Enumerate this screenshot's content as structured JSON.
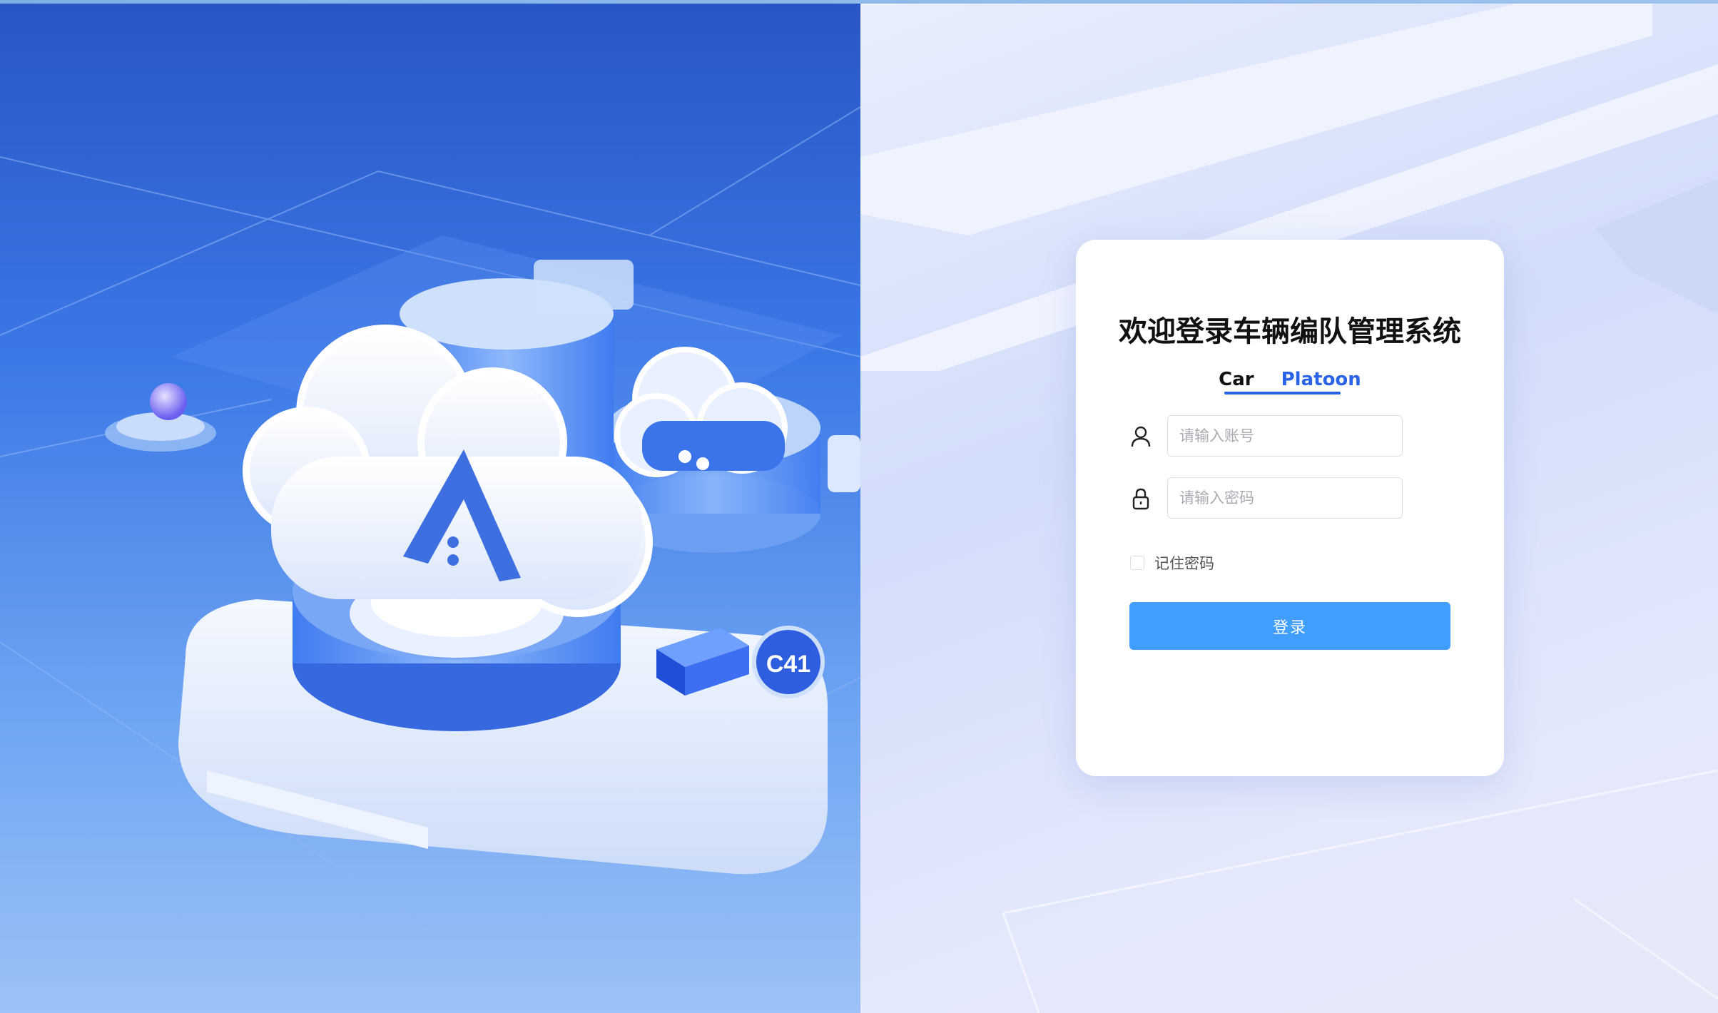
{
  "login": {
    "title": "欢迎登录车辆编队管理系统",
    "tabs": [
      {
        "label": "Car"
      },
      {
        "label": "Platoon"
      }
    ],
    "username": {
      "placeholder": "请输入账号",
      "value": ""
    },
    "password": {
      "placeholder": "请输入密码",
      "value": ""
    },
    "remember_label": "记住密码",
    "remember_checked": false,
    "submit_label": "登录"
  },
  "hero": {
    "badge_text": "C41"
  },
  "colors": {
    "primary_button": "#409eff",
    "active_tab": "#2b63e6",
    "title_text": "#111111"
  }
}
